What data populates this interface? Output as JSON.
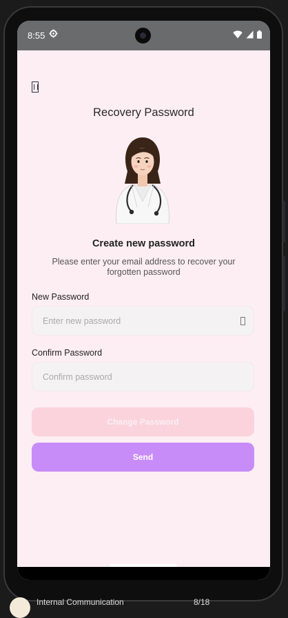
{
  "status_bar": {
    "time": "8:55"
  },
  "screen": {
    "title": "Recovery Password",
    "heading": "Create new password",
    "description": "Please enter your email address to recover your forgotten password",
    "new_password": {
      "label": "New Password",
      "placeholder": "Enter new password"
    },
    "confirm_password": {
      "label": "Confirm Password",
      "placeholder": "Confirm password"
    },
    "change_button": "Change Password",
    "send_button": "Send"
  },
  "background_window": {
    "item_label": "Internal Communication",
    "item_count": "8/18"
  },
  "colors": {
    "screen_bg": "#fdeef3",
    "status_bar_bg": "#6a6b6c",
    "change_button_bg": "#fad3dd",
    "send_button_bg": "#c88cf8",
    "field_bg": "#f5f2f3"
  },
  "icons": [
    "settings-icon",
    "wifi-icon",
    "signal-icon",
    "battery-icon",
    "back-icon",
    "eye-icon",
    "doctor-illustration"
  ]
}
